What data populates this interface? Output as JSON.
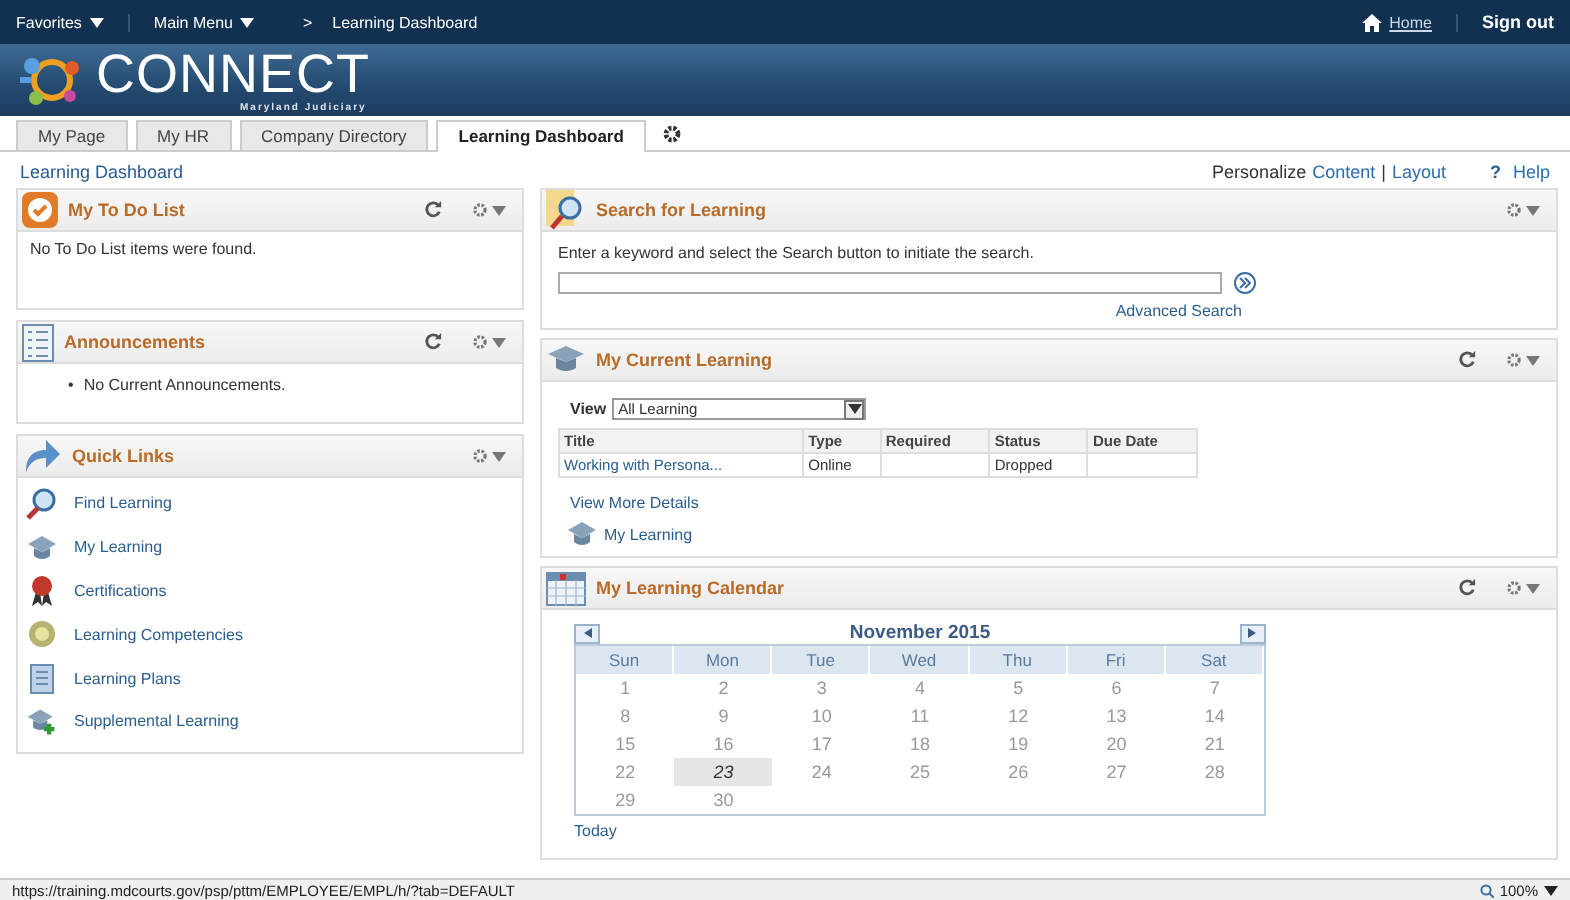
{
  "topbar": {
    "favorites": "Favorites",
    "main_menu": "Main Menu",
    "breadcrumb_sep": ">",
    "breadcrumb": "Learning Dashboard",
    "home": "Home",
    "sign_out": "Sign out"
  },
  "logo": {
    "title": "CONNECT",
    "subtitle": "Maryland Judiciary"
  },
  "tabs": [
    {
      "label": "My Page",
      "selected": false
    },
    {
      "label": "My HR",
      "selected": false
    },
    {
      "label": "Company Directory",
      "selected": false
    },
    {
      "label": "Learning Dashboard",
      "selected": true
    }
  ],
  "page_title": "Learning Dashboard",
  "personalize": {
    "label": "Personalize",
    "content": "Content",
    "sep": "|",
    "layout": "Layout"
  },
  "help": {
    "mark": "?",
    "label": "Help"
  },
  "left_portlets": [
    {
      "kind": "message",
      "title": "My To Do List",
      "refresh": true,
      "text": "No To Do List items were found."
    },
    {
      "kind": "bullets",
      "title": "Announcements",
      "refresh": true,
      "bullet": "•",
      "items": [
        "No Current Announcements."
      ]
    },
    {
      "kind": "links",
      "title": "Quick Links",
      "refresh": false,
      "links": [
        {
          "label": "Find Learning"
        },
        {
          "label": "My Learning"
        },
        {
          "label": "Certifications"
        },
        {
          "label": "Learning Competencies"
        },
        {
          "label": "Learning Plans"
        },
        {
          "label": "Supplemental Learning"
        }
      ]
    }
  ],
  "search": {
    "title": "Search for Learning",
    "refresh": false,
    "instructions": "Enter a keyword and select the Search button to initiate the search.",
    "advanced": "Advanced Search"
  },
  "current_learning": {
    "title": "My Current Learning",
    "refresh": true,
    "view_label": "View",
    "view_value": "All Learning",
    "columns": [
      "Title",
      "Type",
      "Required",
      "Status",
      "Due Date"
    ],
    "rows": [
      [
        "Working with Persona...",
        "Online",
        "",
        "Dropped",
        ""
      ]
    ],
    "view_more": "View More Details",
    "my_learning": "My Learning"
  },
  "calendar": {
    "title": "My Learning Calendar",
    "refresh": true,
    "month": "November 2015",
    "weekdays": [
      "Sun",
      "Mon",
      "Tue",
      "Wed",
      "Thu",
      "Fri",
      "Sat"
    ],
    "weeks": [
      [
        {
          "day": "1",
          "selected": false
        },
        {
          "day": "2",
          "selected": false
        },
        {
          "day": "3",
          "selected": false
        },
        {
          "day": "4",
          "selected": false
        },
        {
          "day": "5",
          "selected": false
        },
        {
          "day": "6",
          "selected": false
        },
        {
          "day": "7",
          "selected": false
        }
      ],
      [
        {
          "day": "8",
          "selected": false
        },
        {
          "day": "9",
          "selected": false
        },
        {
          "day": "10",
          "selected": false
        },
        {
          "day": "11",
          "selected": false
        },
        {
          "day": "12",
          "selected": false
        },
        {
          "day": "13",
          "selected": false
        },
        {
          "day": "14",
          "selected": false
        }
      ],
      [
        {
          "day": "15",
          "selected": false
        },
        {
          "day": "16",
          "selected": false
        },
        {
          "day": "17",
          "selected": false
        },
        {
          "day": "18",
          "selected": false
        },
        {
          "day": "19",
          "selected": false
        },
        {
          "day": "20",
          "selected": false
        },
        {
          "day": "21",
          "selected": false
        }
      ],
      [
        {
          "day": "22",
          "selected": false
        },
        {
          "day": "23",
          "selected": true
        },
        {
          "day": "24",
          "selected": false
        },
        {
          "day": "25",
          "selected": false
        },
        {
          "day": "26",
          "selected": false
        },
        {
          "day": "27",
          "selected": false
        },
        {
          "day": "28",
          "selected": false
        }
      ],
      [
        {
          "day": "29",
          "selected": false
        },
        {
          "day": "30",
          "selected": false
        }
      ]
    ],
    "today": "Today"
  },
  "status_bar": {
    "url": "https://training.mdcourts.gov/psp/pttm/EMPLOYEE/EMPL/h/?tab=DEFAULT",
    "zoom": "100%"
  }
}
